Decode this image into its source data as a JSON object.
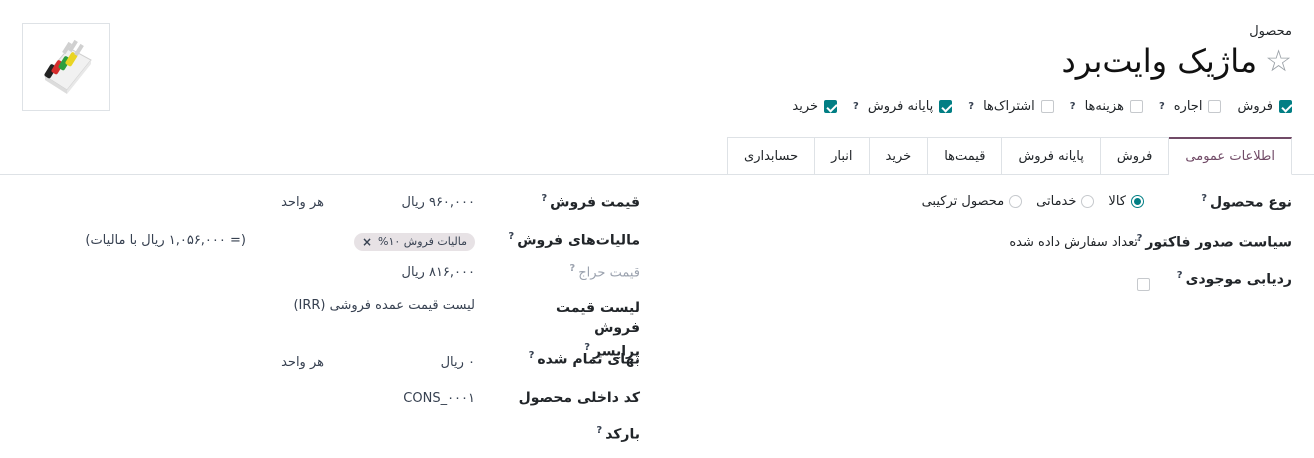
{
  "header": {
    "kind_label": "محصول",
    "product_name": "ماژیک وایت‌برد"
  },
  "options": [
    {
      "label": "فروش",
      "checked": true
    },
    {
      "label": "اجاره",
      "checked": false
    },
    {
      "label": "هزینه‌ها",
      "checked": false
    },
    {
      "label": "اشتراک‌ها",
      "checked": false
    },
    {
      "label": "پایانه فروش",
      "checked": true
    },
    {
      "label": "خرید",
      "checked": true
    }
  ],
  "tabs": [
    "اطلاعات عمومی",
    "فروش",
    "پایانه فروش",
    "قیمت‌ها",
    "خرید",
    "انبار",
    "حسابداری"
  ],
  "right_fields": {
    "product_type_label": "نوع محصول",
    "product_type_options": [
      "کالا",
      "خدماتی",
      "محصول ترکیبی"
    ],
    "invoicing_label": "سیاست صدور فاکتور",
    "invoicing_value": "تعداد سفارش داده شده",
    "tracking_label": "ردیابی موجودی"
  },
  "left_fields": {
    "sales_price_label": "قیمت فروش",
    "sales_price_value": "۹۶۰,۰۰۰ ریال",
    "sales_price_unit": "هر واحد",
    "taxes_label": "مالیات‌های فروش",
    "tax_tag": "مالیات فروش ۱۰%",
    "taxes_included": "(= ۱,۰۵۶,۰۰۰ ریال با مالیات)",
    "discount_label": "قیمت حراج",
    "discount_value": "۸۱۶,۰۰۰ ریال",
    "pricelist_label_1": "لیست قیمت فروش",
    "pricelist_label_2": "پرایسر",
    "pricelist_value": "لیست قیمت عمده فروشی (IRR)",
    "cost_label": "بهای تمام شده",
    "cost_value": "۰ ریال",
    "cost_unit": "هر واحد",
    "ref_label": "کد داخلی محصول",
    "ref_value": "CONS_۰۰۰۱",
    "barcode_label": "بارکد"
  },
  "icons": {
    "help": "?",
    "star": "☆",
    "remove": "×"
  }
}
